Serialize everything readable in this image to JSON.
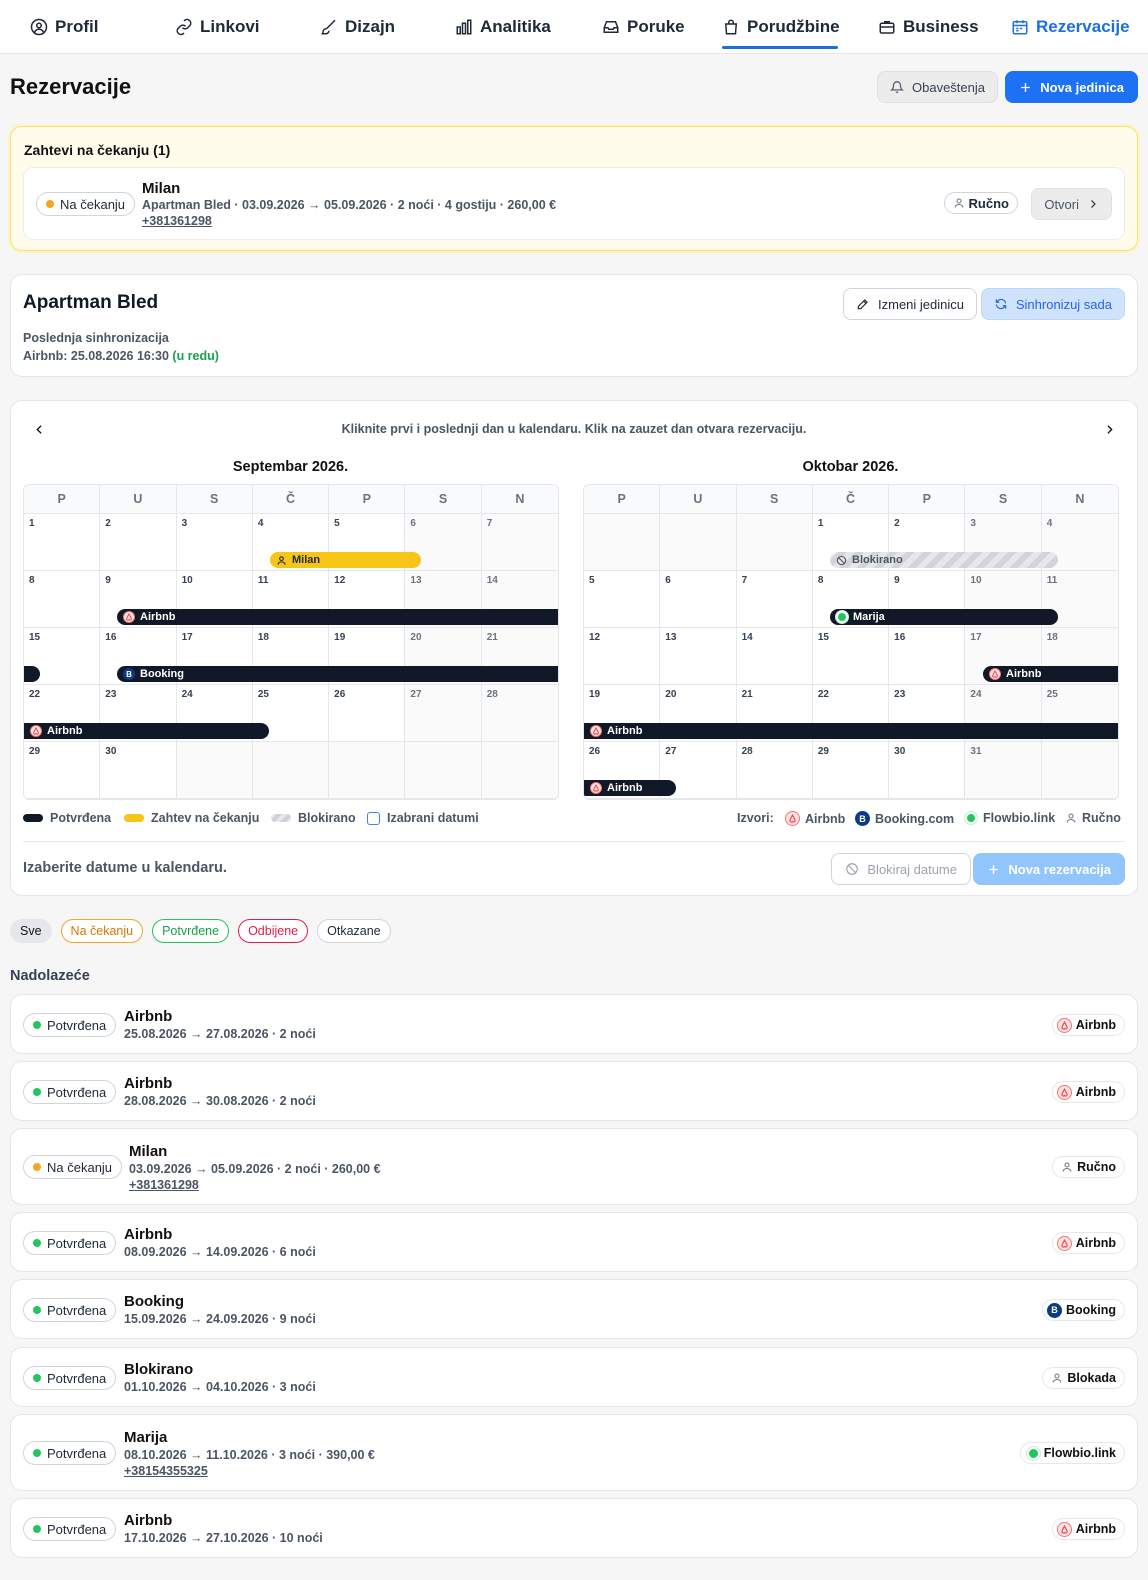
{
  "nav": {
    "tabs": [
      {
        "label": "Profil",
        "icon": "user-icon"
      },
      {
        "label": "Linkovi",
        "icon": "link-icon"
      },
      {
        "label": "Dizajn",
        "icon": "brush-icon"
      },
      {
        "label": "Analitika",
        "icon": "bar-chart-icon"
      },
      {
        "label": "Poruke",
        "icon": "inbox-icon"
      },
      {
        "label": "Porudžbine",
        "icon": "shopping-bag-icon"
      },
      {
        "label": "Business",
        "icon": "briefcase-icon"
      },
      {
        "label": "Rezervacije",
        "icon": "calendar-icon"
      }
    ],
    "active": "Rezervacije"
  },
  "header": {
    "title": "Rezervacije",
    "notifications_label": "Obaveštenja",
    "new_unit_label": "Nova jedinica"
  },
  "pending": {
    "title": "Zahtevi na čekanju (1)",
    "item": {
      "status": "Na čekanju",
      "name": "Milan",
      "details": "Apartman Bled · 03.09.2026 → 05.09.2026 · 2 noći · 4 gostiju · 260,00 €",
      "phone": "+381361298",
      "source": "Ručno",
      "open_label": "Otvori"
    }
  },
  "unit": {
    "title": "Apartman Bled",
    "edit_label": "Izmeni jedinicu",
    "sync_label": "Sinhronizuj sada",
    "last_sync_label": "Poslednja sinhronizacija",
    "last_sync_value": "Airbnb: 25.08.2026 16:30",
    "last_sync_status": "(u redu)"
  },
  "calendar": {
    "hint": "Kliknite prvi i poslednji dan u kalendaru. Klik na zauzet dan otvara rezervaciju.",
    "weekdays": [
      "P",
      "U",
      "S",
      "Č",
      "P",
      "S",
      "N"
    ],
    "months": [
      {
        "title": "Septembar 2026.",
        "offset": 0,
        "days": 30
      },
      {
        "title": "Oktobar 2026.",
        "offset": 3,
        "days": 31
      }
    ],
    "bars": {
      "sep_milan": "Milan",
      "sep_airbnb1": "Airbnb",
      "sep_booking": "Booking",
      "sep_airbnb2": "Airbnb",
      "oct_blocked": "Blokirano",
      "oct_marija": "Marija",
      "oct_airbnb1": "Airbnb",
      "oct_airbnb2": "Airbnb",
      "oct_airbnb3": "Airbnb"
    },
    "legend": {
      "confirmed": "Potvrđena",
      "pending": "Zahtev na čekanju",
      "blocked": "Blokirano",
      "selected": "Izabrani datumi",
      "sources_label": "Izvori:",
      "sources": [
        "Airbnb",
        "Booking.com",
        "Flowbio.link",
        "Ručno"
      ]
    },
    "choose_text": "Izaberite datume u kalendaru.",
    "block_label": "Blokiraj datume",
    "new_reservation_label": "Nova rezervacija"
  },
  "filters": [
    "Sve",
    "Na čekanju",
    "Potvrđene",
    "Odbijene",
    "Otkazane"
  ],
  "upcoming": {
    "title": "Nadolazeće",
    "items": [
      {
        "status": "Potvrđena",
        "name": "Airbnb",
        "details": "25.08.2026 → 27.08.2026 · 2 noći",
        "phone": "",
        "source": "Airbnb"
      },
      {
        "status": "Potvrđena",
        "name": "Airbnb",
        "details": "28.08.2026 → 30.08.2026 · 2 noći",
        "phone": "",
        "source": "Airbnb"
      },
      {
        "status": "Na čekanju",
        "name": "Milan",
        "details": "03.09.2026 → 05.09.2026 · 2 noći · 260,00 €",
        "phone": "+381361298",
        "source": "Ručno"
      },
      {
        "status": "Potvrđena",
        "name": "Airbnb",
        "details": "08.09.2026 → 14.09.2026 · 6 noći",
        "phone": "",
        "source": "Airbnb"
      },
      {
        "status": "Potvrđena",
        "name": "Booking",
        "details": "15.09.2026 → 24.09.2026 · 9 noći",
        "phone": "",
        "source": "Booking"
      },
      {
        "status": "Potvrđena",
        "name": "Blokirano",
        "details": "01.10.2026 → 04.10.2026 · 3 noći",
        "phone": "",
        "source": "Blokada"
      },
      {
        "status": "Potvrđena",
        "name": "Marija",
        "details": "08.10.2026 → 11.10.2026 · 3 noći · 390,00 €",
        "phone": "+38154355325",
        "source": "Flowbio.link"
      },
      {
        "status": "Potvrđena",
        "name": "Airbnb",
        "details": "17.10.2026 → 27.10.2026 · 10 noći",
        "phone": "",
        "source": "Airbnb"
      }
    ]
  },
  "colors": {
    "accent": "#1d72f3",
    "confirmed": "#111827",
    "pending": "#f5c518",
    "green": "#22c55e",
    "orange": "#f5a524"
  }
}
